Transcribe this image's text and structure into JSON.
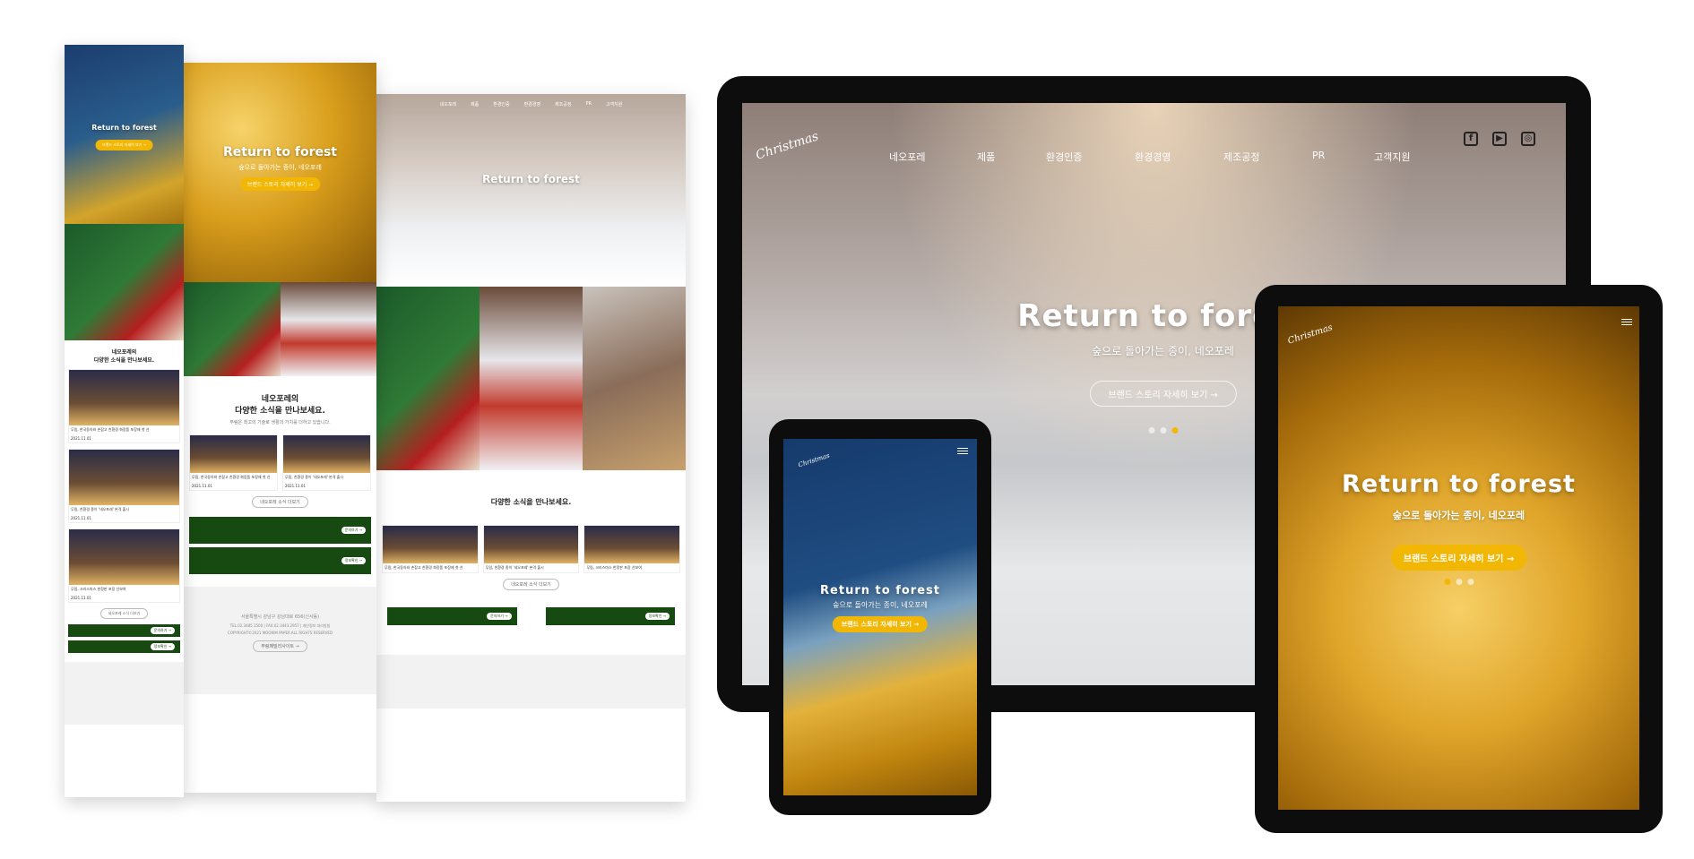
{
  "hero": {
    "title": "Return to forest",
    "subtitle": "숲으로 돌아가는 종이, 네오포레",
    "cta": "브랜드 스토리 자세히 보기 →",
    "logo": "Christmas"
  },
  "nav": {
    "items": [
      "네오포레",
      "제품",
      "환경인증",
      "환경경영",
      "제조공정",
      "PR",
      "고객지원"
    ]
  },
  "social": {
    "facebook": "f",
    "youtube": "▶",
    "instagram": "◎"
  },
  "news": {
    "title_line1": "네오포레의",
    "title_line2": "다양한 소식을 만나보세요.",
    "subtitle": "무림은 최고의 기술로 생활의 가치를 더하고 있습니다.",
    "more": "네오포레 소식 더보기",
    "items": [
      {
        "title": "무림, 한국동아와 손잡고 친환경 화장품 포장재 첫 선",
        "date": "2021.11.01"
      },
      {
        "title": "무림, 친환경 종이 '네오포레' 본격 출시",
        "date": "2021.11.01"
      },
      {
        "title": "무림, 크리스마스 한정판 포장 선보여",
        "date": "2021.11.01"
      }
    ]
  },
  "side_boxes": {
    "contact": "문의하기 →",
    "info": "정보확인 →"
  },
  "footer": {
    "address": "서울특별시 강남구 강남대로 656(신사동)",
    "contact": "TEL.02.3485.1500 | FAX.02.3443.2957 | 개인정보 처리방침",
    "copy": "COPYRIGHT©2021 MOORIM PAPER.ALL RIGHTS RESERVED",
    "family": "무림패밀리사이트 →"
  },
  "colors": {
    "accent": "#f2b705",
    "green": "#174a10",
    "device": "#0d0d0d"
  }
}
